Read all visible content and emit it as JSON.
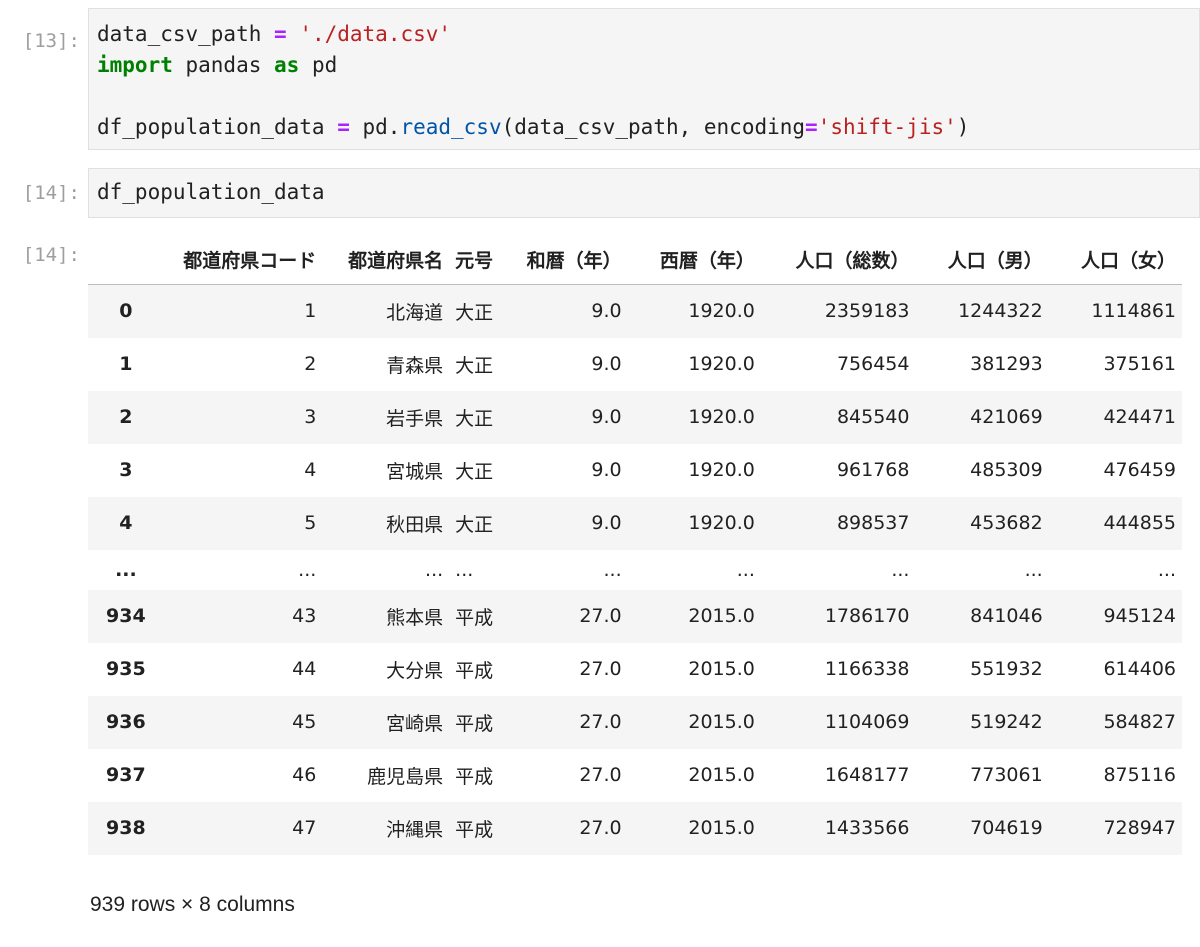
{
  "cells": [
    {
      "prompt": "[13]:",
      "code_parts": {
        "line1_var": "data_csv_path ",
        "line1_op": "=",
        "line1_str": " './data.csv'",
        "line2_kw1": "import",
        "line2_mid": " pandas ",
        "line2_kw2": "as",
        "line2_end": " pd",
        "line4_var": "df_population_data ",
        "line4_op": "=",
        "line4_mod": " pd.",
        "line4_fn": "read_csv",
        "line4_args1": "(data_csv_path, encoding",
        "line4_op2": "=",
        "line4_str": "'shift-jis'",
        "line4_close": ")"
      }
    },
    {
      "prompt": "[14]:",
      "code": "df_population_data"
    }
  ],
  "output": {
    "prompt": "[14]:",
    "columns": [
      "都道府県コード",
      "都道府県名",
      "元号",
      "和暦（年）",
      "西暦（年）",
      "人口（総数）",
      "人口（男）",
      "人口（女）"
    ],
    "rows": [
      {
        "index": "0",
        "cells": [
          "1",
          "北海道",
          "大正",
          "9.0",
          "1920.0",
          "2359183",
          "1244322",
          "1114861"
        ]
      },
      {
        "index": "1",
        "cells": [
          "2",
          "青森県",
          "大正",
          "9.0",
          "1920.0",
          "756454",
          "381293",
          "375161"
        ]
      },
      {
        "index": "2",
        "cells": [
          "3",
          "岩手県",
          "大正",
          "9.0",
          "1920.0",
          "845540",
          "421069",
          "424471"
        ]
      },
      {
        "index": "3",
        "cells": [
          "4",
          "宮城県",
          "大正",
          "9.0",
          "1920.0",
          "961768",
          "485309",
          "476459"
        ]
      },
      {
        "index": "4",
        "cells": [
          "5",
          "秋田県",
          "大正",
          "9.0",
          "1920.0",
          "898537",
          "453682",
          "444855"
        ]
      },
      {
        "index": "...",
        "cells": [
          "...",
          "...",
          "...",
          "...",
          "...",
          "...",
          "...",
          "..."
        ]
      },
      {
        "index": "934",
        "cells": [
          "43",
          "熊本県",
          "平成",
          "27.0",
          "2015.0",
          "1786170",
          "841046",
          "945124"
        ]
      },
      {
        "index": "935",
        "cells": [
          "44",
          "大分県",
          "平成",
          "27.0",
          "2015.0",
          "1166338",
          "551932",
          "614406"
        ]
      },
      {
        "index": "936",
        "cells": [
          "45",
          "宮崎県",
          "平成",
          "27.0",
          "2015.0",
          "1104069",
          "519242",
          "584827"
        ]
      },
      {
        "index": "937",
        "cells": [
          "46",
          "鹿児島県",
          "平成",
          "27.0",
          "2015.0",
          "1648177",
          "773061",
          "875116"
        ]
      },
      {
        "index": "938",
        "cells": [
          "47",
          "沖縄県",
          "平成",
          "27.0",
          "2015.0",
          "1433566",
          "704619",
          "728947"
        ]
      }
    ],
    "summary": "939 rows × 8 columns"
  }
}
